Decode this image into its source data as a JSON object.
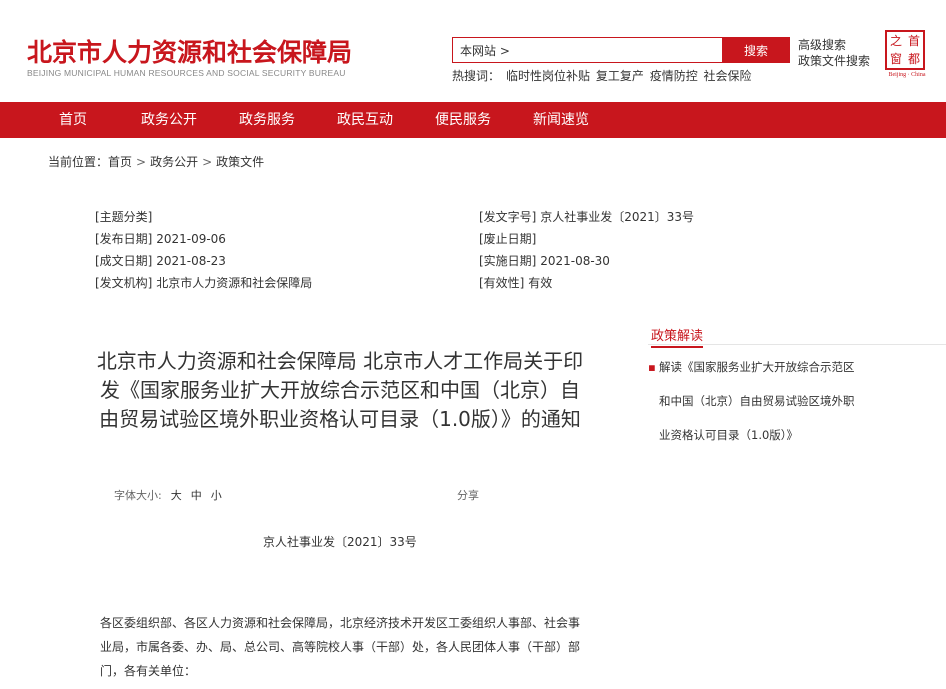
{
  "header": {
    "site_title": "北京市人力资源和社会保障局",
    "site_title_en": "BEIJING MUNICIPAL HUMAN RESOURCES AND SOCIAL SECURITY BUREAU",
    "search_scope": "本网站 >",
    "search_button": "搜索",
    "advanced_search": "高级搜索",
    "policy_search": "政策文件搜索",
    "hot_label": "热搜词：",
    "hot_words": [
      "临时性岗位补贴",
      "复工复产",
      "疫情防控",
      "社会保险"
    ],
    "seal_chars": [
      "之",
      "首",
      "窗",
      "都"
    ],
    "seal_en": "Beijing · China"
  },
  "nav": {
    "items": [
      "首页",
      "政务公开",
      "政务服务",
      "政民互动",
      "便民服务",
      "新闻速览"
    ]
  },
  "breadcrumb": {
    "label": "当前位置：",
    "items": [
      "首页",
      "政务公开",
      "政策文件"
    ],
    "separator": ">"
  },
  "meta": {
    "topic_label": "[主题分类]",
    "topic_value": "",
    "doc_no_label": "[发文字号]",
    "doc_no_value": "京人社事业发〔2021〕33号",
    "publish_label": "[发布日期]",
    "publish_value": "2021-09-06",
    "abolish_label": "[废止日期]",
    "abolish_value": "",
    "written_label": "[成文日期]",
    "written_value": "2021-08-23",
    "effective_label": "[实施日期]",
    "effective_value": "2021-08-30",
    "issuer_label": "[发文机构]",
    "issuer_value": "北京市人力资源和社会保障局",
    "validity_label": "[有效性]",
    "validity_value": "有效"
  },
  "article": {
    "title": "北京市人力资源和社会保障局 北京市人才工作局关于印发《国家服务业扩大开放综合示范区和中国（北京）自由贸易试验区境外职业资格认可目录（1.0版）》的通知",
    "font_size_label": "字体大小:",
    "font_options": [
      "大",
      "中",
      "小"
    ],
    "share_label": "分享",
    "doc_number": "京人社事业发〔2021〕33号",
    "salutation": "各区委组织部、各区人力资源和社会保障局，北京经济技术开发区工委组织人事部、社会事业局，市属各委、办、局、总公司、高等院校人事（干部）处，各人民团体人事（干部）部门，各有关单位："
  },
  "sidebar": {
    "policy_title": "政策解读",
    "policy_item": "解读《国家服务业扩大开放综合示范区和中国（北京）自由贸易试验区境外职业资格认可目录（1.0版）》"
  },
  "colors": {
    "brand_red": "#c8161d"
  }
}
